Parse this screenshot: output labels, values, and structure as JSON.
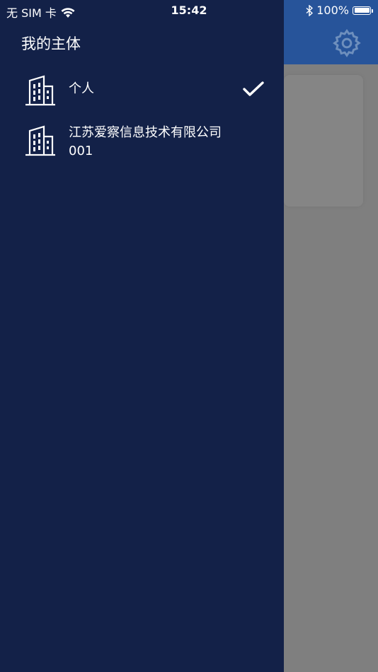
{
  "status_bar": {
    "carrier": "无 SIM 卡",
    "time": "15:42",
    "battery": "100%"
  },
  "drawer": {
    "title": "我的主体",
    "entities": [
      {
        "name": "个人",
        "selected": true
      },
      {
        "name": "江苏爱察信息技术有限公司 001",
        "selected": false
      }
    ]
  },
  "icons": {
    "entity": "building-icon",
    "selected": "checkmark-icon",
    "settings": "gear-icon",
    "wifi": "wifi-icon",
    "bluetooth": "bluetooth-icon"
  },
  "colors": {
    "drawer_bg": "#132148",
    "header_bg": "#27549a",
    "overlay_bg": "#7f7f7f"
  }
}
